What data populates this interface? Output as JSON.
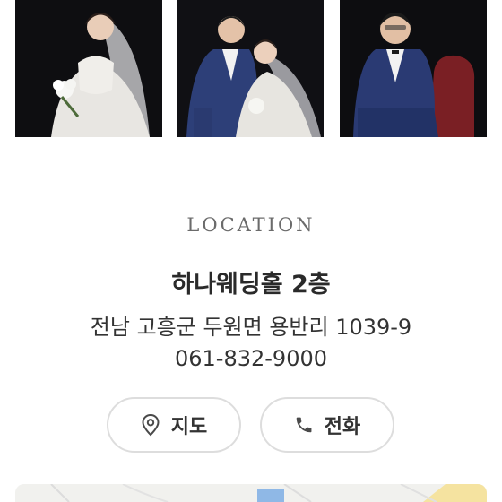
{
  "location": {
    "heading": "LOCATION",
    "venue": "하나웨딩홀 2층",
    "address": "전남 고흥군 두원면 용반리 1039-9",
    "phone": "061-832-9000"
  },
  "buttons": {
    "map_label": "지도",
    "call_label": "전화"
  },
  "gallery": {
    "photos": [
      "bride-portrait",
      "couple-portrait",
      "groom-portrait"
    ]
  },
  "colors": {
    "accent": "#4a4a4a",
    "button_border": "#dddddd",
    "photo_background": "#0f0f12",
    "map_water": "#8fb8e6"
  }
}
